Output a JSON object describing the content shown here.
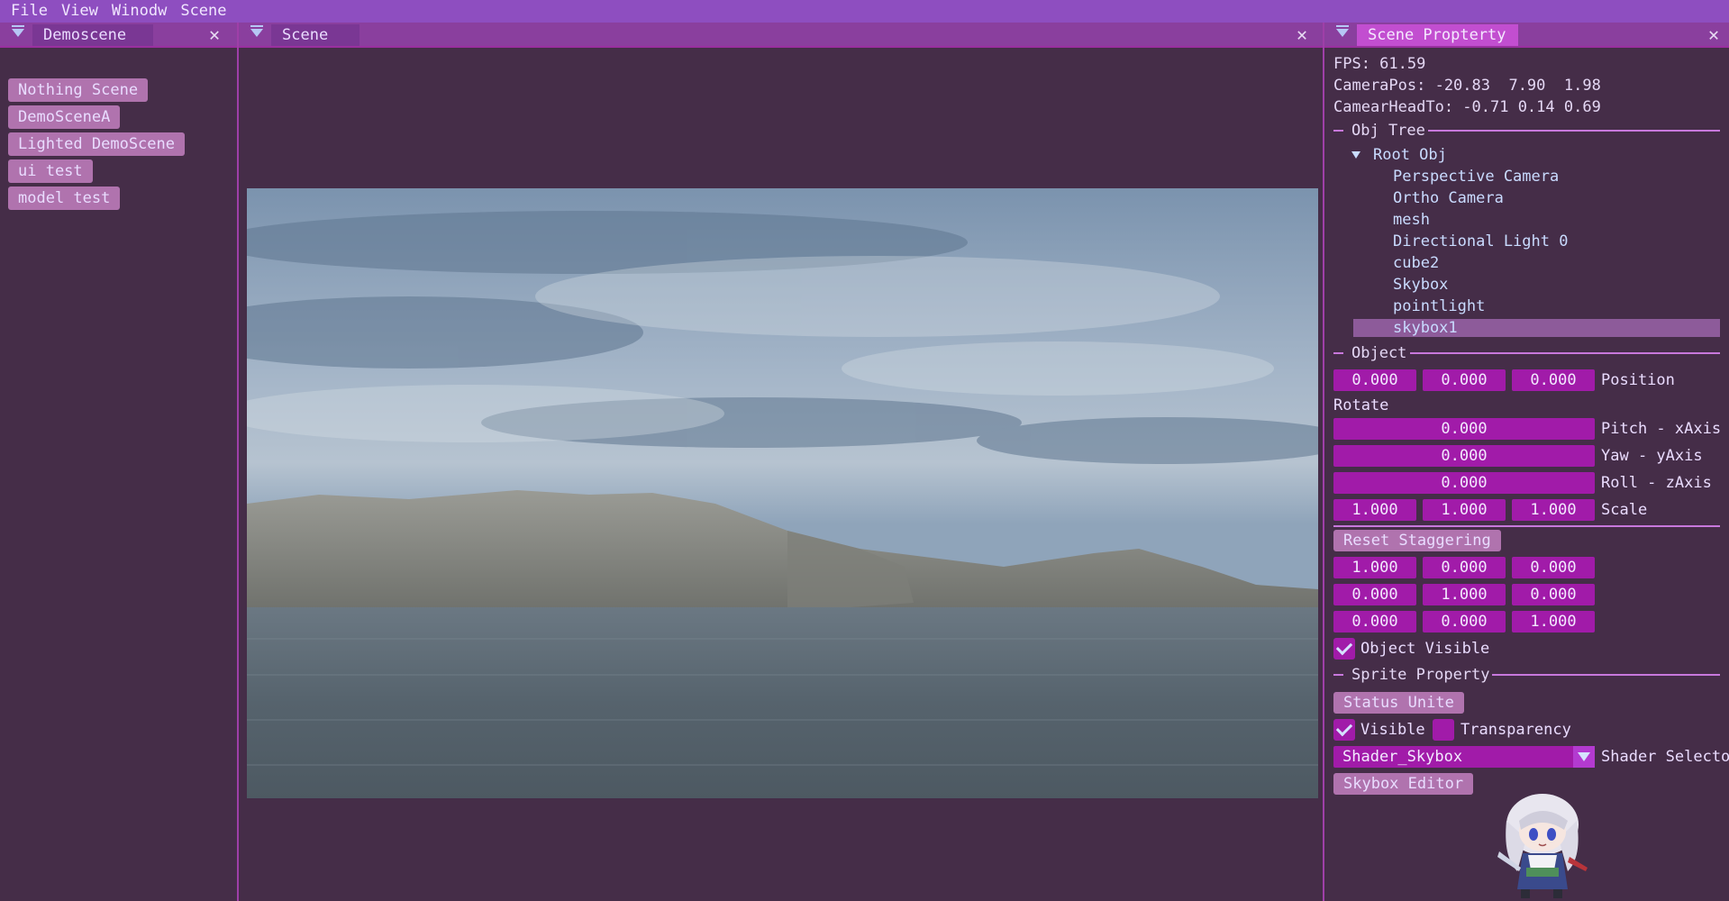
{
  "menubar": {
    "items": [
      "File",
      "View",
      "Winodw",
      "Scene"
    ]
  },
  "left_panel": {
    "tab": "Demoscene",
    "scenes": [
      "Nothing Scene",
      "DemoSceneA",
      "Lighted DemoScene",
      "ui test",
      "model test"
    ]
  },
  "center_panel": {
    "tab": "Scene"
  },
  "right_panel": {
    "tab": "Scene Propterty",
    "fps": "FPS: 61.59",
    "camera_pos": "CameraPos: -20.83  7.90  1.98",
    "camera_head": "CamearHeadTo: -0.71 0.14 0.69",
    "obj_tree_header": "Obj Tree",
    "tree": {
      "root": "Root Obj",
      "children": [
        "Perspective Camera",
        "Ortho Camera",
        "mesh",
        "Directional Light 0",
        "cube2",
        "Skybox",
        "pointlight",
        "skybox1"
      ],
      "selected": "skybox1"
    },
    "object_header": "Object",
    "position": {
      "values": [
        "0.000",
        "0.000",
        "0.000"
      ],
      "label": "Position"
    },
    "rotate_label": "Rotate",
    "rotations": [
      {
        "value": "0.000",
        "label": "Pitch - xAxis"
      },
      {
        "value": "0.000",
        "label": "Yaw - yAxis"
      },
      {
        "value": "0.000",
        "label": "Roll - zAxis"
      }
    ],
    "scale": {
      "values": [
        "1.000",
        "1.000",
        "1.000"
      ],
      "label": "Scale"
    },
    "reset_staggering": "Reset Staggering",
    "matrix": [
      [
        "1.000",
        "0.000",
        "0.000"
      ],
      [
        "0.000",
        "1.000",
        "0.000"
      ],
      [
        "0.000",
        "0.000",
        "1.000"
      ]
    ],
    "object_visible": {
      "label": "Object Visible",
      "checked": true
    },
    "sprite_header": "Sprite Property",
    "status_unite": "Status Unite",
    "visible": {
      "label": "Visible",
      "checked": true
    },
    "transparency": {
      "label": "Transparency",
      "checked": false
    },
    "shader": {
      "value": "Shader_Skybox",
      "label": "Shader Selecto"
    },
    "skybox_editor": "Skybox Editor"
  },
  "colors": {
    "menubar": "#8e4ec0",
    "panel_bg": "#452d48",
    "field": "#a11ba9",
    "button": "#b073ae",
    "accent_line": "#c878dc",
    "active_tab": "#c24ed0"
  },
  "icons": [
    "collapse-arrow-icon",
    "close-icon",
    "tree-expand-icon",
    "checkmark-icon",
    "dropdown-arrow-icon"
  ]
}
